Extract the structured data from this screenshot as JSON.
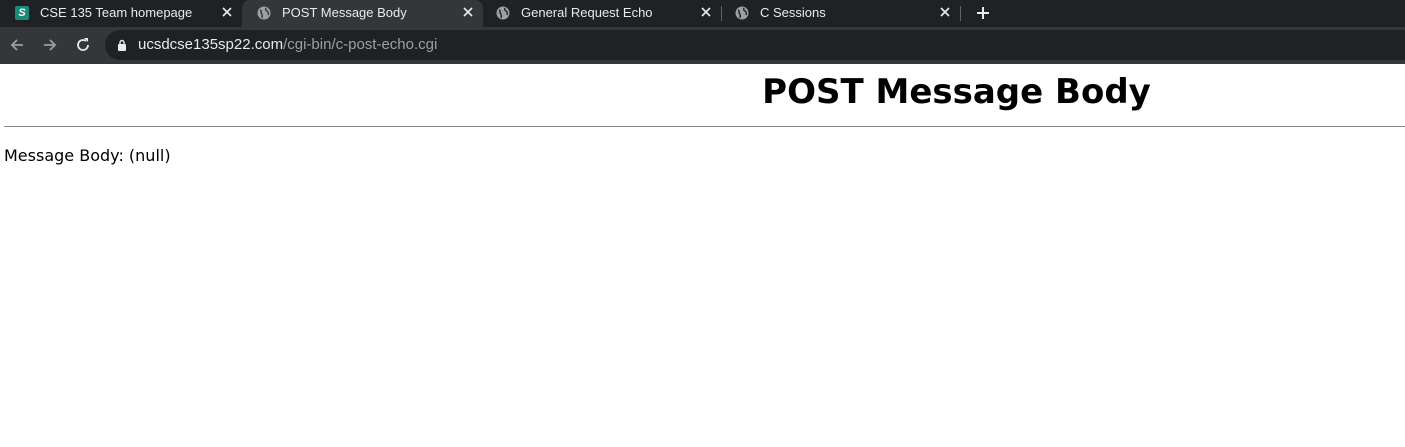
{
  "tabs": [
    {
      "title": "CSE 135 Team homepage",
      "icon": "site-s-icon",
      "active": false
    },
    {
      "title": "POST Message Body",
      "icon": "globe-icon",
      "active": true
    },
    {
      "title": "General Request Echo",
      "icon": "globe-icon",
      "active": false
    },
    {
      "title": "C Sessions",
      "icon": "globe-icon",
      "active": false
    }
  ],
  "tab_icon_letter": "S",
  "close_glyph": "✕",
  "new_tab_glyph": "+",
  "address_bar": {
    "host": "ucsdcse135sp22.com",
    "path": "/cgi-bin/c-post-echo.cgi"
  },
  "page": {
    "heading": "POST Message Body",
    "message_label": "Message Body: (null)"
  },
  "colors": {
    "tab_strip": "#202124",
    "active_tab": "#35363a",
    "favicon_teal": "#1a8a7a",
    "text_light": "#e8eaed",
    "text_dim": "#9aa0a6"
  }
}
